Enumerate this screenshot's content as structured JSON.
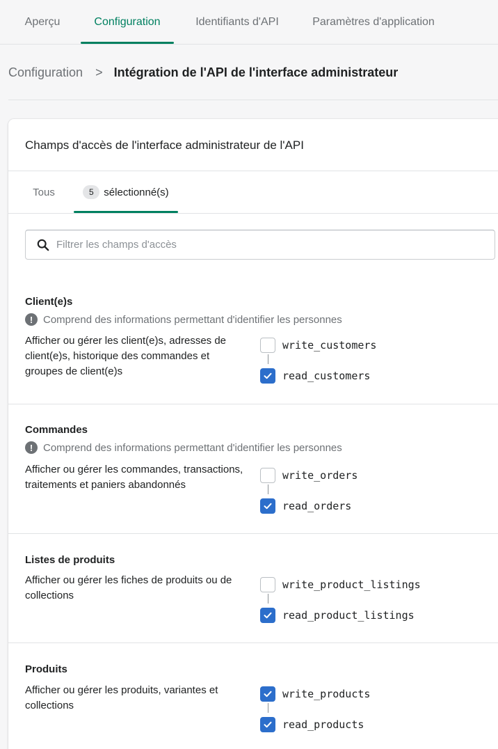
{
  "top_tabs": [
    {
      "label": "Aperçu",
      "active": false
    },
    {
      "label": "Configuration",
      "active": true
    },
    {
      "label": "Identifiants d'API",
      "active": false
    },
    {
      "label": "Paramètres d'application",
      "active": false
    }
  ],
  "breadcrumb": {
    "parent": "Configuration",
    "separator": ">",
    "current": "Intégration de l'API de l'interface administrateur"
  },
  "card": {
    "title": "Champs d'accès de l'interface administrateur de l'API",
    "tabs": {
      "all_label": "Tous",
      "selected_count": "5",
      "selected_label": "sélectionné(s)"
    },
    "search": {
      "placeholder": "Filtrer les champs d'accès",
      "value": ""
    }
  },
  "sections": [
    {
      "title": "Client(e)s",
      "warning": "Comprend des informations permettant d'identifier les personnes",
      "description": "Afficher ou gérer les client(e)s, adresses de client(e)s, historique des commandes et groupes de client(e)s",
      "scopes": [
        {
          "label": "write_customers",
          "checked": false
        },
        {
          "label": "read_customers",
          "checked": true
        }
      ]
    },
    {
      "title": "Commandes",
      "warning": "Comprend des informations permettant d'identifier les personnes",
      "description": "Afficher ou gérer les commandes, transactions, traitements et paniers abandonnés",
      "scopes": [
        {
          "label": "write_orders",
          "checked": false
        },
        {
          "label": "read_orders",
          "checked": true
        }
      ]
    },
    {
      "title": "Listes de produits",
      "warning": "",
      "description": "Afficher ou gérer les fiches de produits ou de collections",
      "scopes": [
        {
          "label": "write_product_listings",
          "checked": false
        },
        {
          "label": "read_product_listings",
          "checked": true
        }
      ]
    },
    {
      "title": "Produits",
      "warning": "",
      "description": "Afficher ou gérer les produits, variantes et collections",
      "scopes": [
        {
          "label": "write_products",
          "checked": true
        },
        {
          "label": "read_products",
          "checked": true
        }
      ]
    }
  ],
  "colors": {
    "accent": "#008060",
    "checkbox_checked": "#2c6ecb",
    "muted_text": "#6d7175"
  },
  "icons": {
    "search": "search-icon",
    "warning": "info-circle-icon",
    "breadcrumb_separator": "chevron-right-icon",
    "check": "checkmark-icon"
  }
}
